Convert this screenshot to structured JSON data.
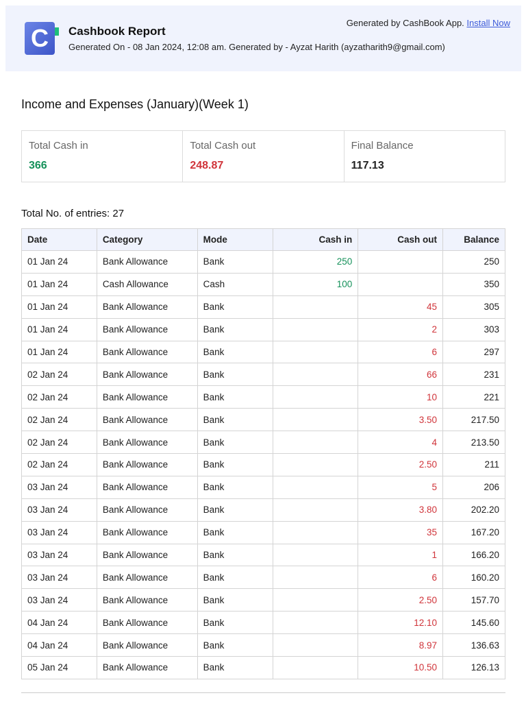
{
  "header": {
    "logo_letter": "C",
    "title": "Cashbook Report",
    "subtitle": "Generated On - 08 Jan 2024, 12:08 am. Generated by - Ayzat Harith (ayzatharith9@gmail.com)",
    "generated_by": "Generated by CashBook App.",
    "install_link": "Install Now"
  },
  "report_title": "Income and Expenses (January)(Week 1)",
  "summary": {
    "cash_in_label": "Total Cash in",
    "cash_in": "366",
    "cash_out_label": "Total Cash out",
    "cash_out": "248.87",
    "balance_label": "Final Balance",
    "balance": "117.13"
  },
  "entries_label": "Total No. of entries: 27",
  "colors": {
    "in": "#15915a",
    "out": "#d0343a",
    "header_bg": "#f0f3fd"
  },
  "table": {
    "headers": [
      "Date",
      "Category",
      "Mode",
      "Cash in",
      "Cash out",
      "Balance"
    ],
    "rows": [
      [
        "01 Jan 24",
        "Bank Allowance",
        "Bank",
        "250",
        "",
        "250"
      ],
      [
        "01 Jan 24",
        "Cash Allowance",
        "Cash",
        "100",
        "",
        "350"
      ],
      [
        "01 Jan 24",
        "Bank Allowance",
        "Bank",
        "",
        "45",
        "305"
      ],
      [
        "01 Jan 24",
        "Bank Allowance",
        "Bank",
        "",
        "2",
        "303"
      ],
      [
        "01 Jan 24",
        "Bank Allowance",
        "Bank",
        "",
        "6",
        "297"
      ],
      [
        "02 Jan 24",
        "Bank Allowance",
        "Bank",
        "",
        "66",
        "231"
      ],
      [
        "02 Jan 24",
        "Bank Allowance",
        "Bank",
        "",
        "10",
        "221"
      ],
      [
        "02 Jan 24",
        "Bank Allowance",
        "Bank",
        "",
        "3.50",
        "217.50"
      ],
      [
        "02 Jan 24",
        "Bank Allowance",
        "Bank",
        "",
        "4",
        "213.50"
      ],
      [
        "02 Jan 24",
        "Bank Allowance",
        "Bank",
        "",
        "2.50",
        "211"
      ],
      [
        "03 Jan 24",
        "Bank Allowance",
        "Bank",
        "",
        "5",
        "206"
      ],
      [
        "03 Jan 24",
        "Bank Allowance",
        "Bank",
        "",
        "3.80",
        "202.20"
      ],
      [
        "03 Jan 24",
        "Bank Allowance",
        "Bank",
        "",
        "35",
        "167.20"
      ],
      [
        "03 Jan 24",
        "Bank Allowance",
        "Bank",
        "",
        "1",
        "166.20"
      ],
      [
        "03 Jan 24",
        "Bank Allowance",
        "Bank",
        "",
        "6",
        "160.20"
      ],
      [
        "03 Jan 24",
        "Bank Allowance",
        "Bank",
        "",
        "2.50",
        "157.70"
      ],
      [
        "04 Jan 24",
        "Bank Allowance",
        "Bank",
        "",
        "12.10",
        "145.60"
      ],
      [
        "04 Jan 24",
        "Bank Allowance",
        "Bank",
        "",
        "8.97",
        "136.63"
      ],
      [
        "05 Jan 24",
        "Bank Allowance",
        "Bank",
        "",
        "10.50",
        "126.13"
      ]
    ]
  }
}
